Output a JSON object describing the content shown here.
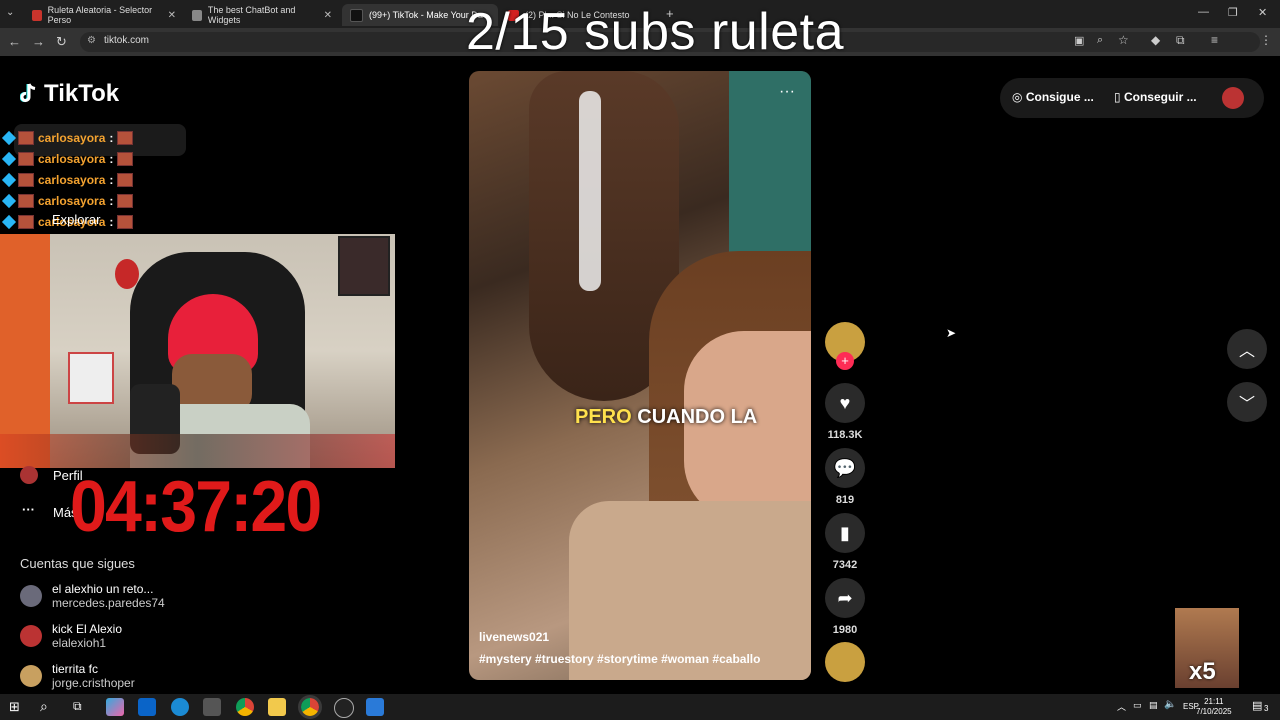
{
  "overlay": {
    "title": "2/15 subs ruleta"
  },
  "browser": {
    "tabs": [
      {
        "label": "Ruleta Aleatoria - Selector Perso",
        "color": "#c9342c"
      },
      {
        "label": "The best ChatBot and Widgets",
        "color": "#555555"
      },
      {
        "label": "(99+) TikTok - Make Your Da",
        "color": "#111111"
      },
      {
        "label": "(2) Pl... Si No Le Contesto",
        "color": "#d32020"
      }
    ],
    "url": "tiktok.com"
  },
  "tiktok": {
    "logo": "TikTok",
    "chat": [
      {
        "user": "carlosayora"
      },
      {
        "user": "carlosayora"
      },
      {
        "user": "carlosayora"
      },
      {
        "user": "carlosayora"
      },
      {
        "user": "carlosayora"
      }
    ],
    "sidebar_explore": "Explorar",
    "sidebar_profile": "Perfil",
    "sidebar_more": "Más",
    "timer": "04:37:20",
    "following_title": "Cuentas que sigues",
    "accounts": [
      {
        "name": "el alexhio un reto...",
        "handle": "mercedes.paredes74"
      },
      {
        "name": "kick El Alexio",
        "handle": "elalexioh1"
      },
      {
        "name": "tierrita fc",
        "handle": "jorge.cristhoper"
      }
    ],
    "video": {
      "caption_highlight": "PERO",
      "caption_rest": "CUANDO LA",
      "username": "livenews021",
      "tags": "#mystery  #truestory  #storytime  #woman  #caballo"
    },
    "actions": {
      "likes": "118.3K",
      "comments": "819",
      "saves": "7342",
      "shares": "1980"
    },
    "top_right": {
      "coins": "Consigue ...",
      "app": "Conseguir ..."
    }
  },
  "taskbar": {
    "lang": "ESP",
    "time": "21:11",
    "date": "7/10/2025",
    "notifications": "3"
  },
  "stream_badge": "x5"
}
